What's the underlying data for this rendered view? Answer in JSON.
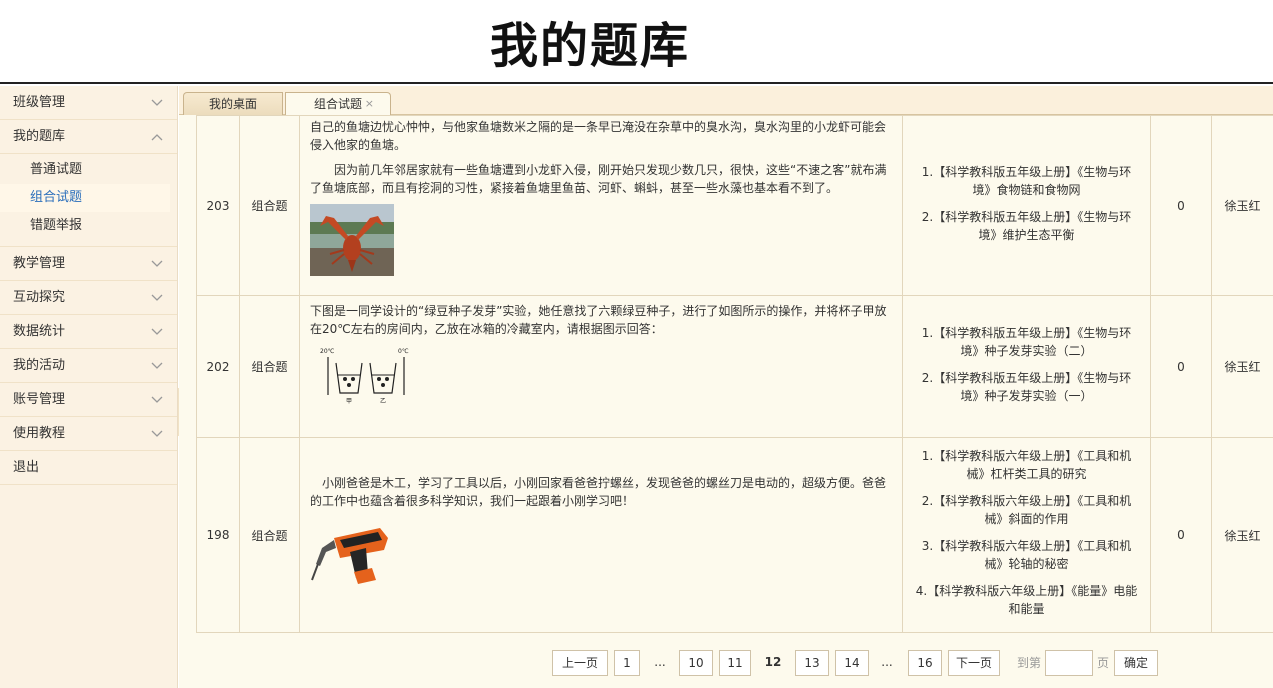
{
  "header": {
    "title": "我的题库"
  },
  "sidebar": {
    "items": [
      {
        "label": "班级管理",
        "icon": "chevron-down-icon"
      },
      {
        "label": "我的题库",
        "icon": "chevron-up-icon",
        "expanded": true,
        "children": [
          {
            "label": "普通试题",
            "active": false
          },
          {
            "label": "组合试题",
            "active": true
          },
          {
            "label": "错题举报",
            "active": false
          }
        ]
      },
      {
        "label": "教学管理",
        "icon": "chevron-down-icon"
      },
      {
        "label": "互动探究",
        "icon": "chevron-down-icon"
      },
      {
        "label": "数据统计",
        "icon": "chevron-down-icon"
      },
      {
        "label": "我的活动",
        "icon": "chevron-down-icon"
      },
      {
        "label": "账号管理",
        "icon": "chevron-down-icon"
      },
      {
        "label": "使用教程",
        "icon": "chevron-down-icon"
      },
      {
        "label": "退出"
      }
    ]
  },
  "tabs": [
    {
      "label": "我的桌面",
      "closable": false,
      "active": false
    },
    {
      "label": "组合试题",
      "closable": true,
      "close_glyph": "×",
      "active": true
    }
  ],
  "rows": [
    {
      "id": "203",
      "type": "组合题",
      "paragraphs": [
        "自己的鱼塘边忧心忡忡，与他家鱼塘数米之隔的是一条早已淹没在杂草中的臭水沟，臭水沟里的小龙虾可能会侵入他家的鱼塘。",
        "　　因为前几年邻居家就有一些鱼塘遭到小龙虾入侵，刚开始只发现少数几只，很快，这些“不速之客”就布满了鱼塘底部，而且有挖洞的习性，紧接着鱼塘里鱼苗、河虾、蝌蚪，甚至一些水藻也基本看不到了。"
      ],
      "image": "crayfish-photo",
      "knowledge_points": [
        "1.【科学教科版五年级上册】《生物与环境》食物链和食物网",
        "2.【科学教科版五年级上册】《生物与环境》维护生态平衡"
      ],
      "count": "0",
      "author": "徐玉红"
    },
    {
      "id": "202",
      "type": "组合题",
      "paragraphs": [
        "下图是一同学设计的“绿豆种子发芽”实验，她任意找了六颗绿豆种子，进行了如图所示的操作，并将杯子甲放在20℃左右的房间内，乙放在冰箱的冷藏室内，请根据图示回答："
      ],
      "image": "seed-germination-diagram",
      "diagram_labels": {
        "left_temp": "20℃",
        "right_temp": "0℃",
        "left_cup": "甲",
        "right_cup": "乙"
      },
      "knowledge_points": [
        "1.【科学教科版五年级上册】《生物与环境》种子发芽实验（二）",
        "2.【科学教科版五年级上册】《生物与环境》种子发芽实验（一）"
      ],
      "count": "0",
      "author": "徐玉红"
    },
    {
      "id": "198",
      "type": "组合题",
      "paragraphs": [
        "　小刚爸爸是木工，学习了工具以后，小刚回家看爸爸拧螺丝，发现爸爸的螺丝刀是电动的，超级方便。爸爸的工作中也蕴含着很多科学知识，我们一起跟着小刚学习吧！"
      ],
      "image": "electric-drill-photo",
      "knowledge_points": [
        "1.【科学教科版六年级上册】《工具和机械》杠杆类工具的研究",
        "2.【科学教科版六年级上册】《工具和机械》斜面的作用",
        "3.【科学教科版六年级上册】《工具和机械》轮轴的秘密",
        "4.【科学教科版六年级上册】《能量》电能和能量"
      ],
      "count": "0",
      "author": "徐玉红"
    }
  ],
  "pagination": {
    "prev": "上一页",
    "pages": [
      "1",
      "...",
      "10",
      "11",
      "12",
      "13",
      "14",
      "...",
      "16"
    ],
    "current": "12",
    "next": "下一页",
    "goto_label": "到第",
    "page_unit": "页",
    "goto_value": "",
    "confirm": "确定"
  }
}
